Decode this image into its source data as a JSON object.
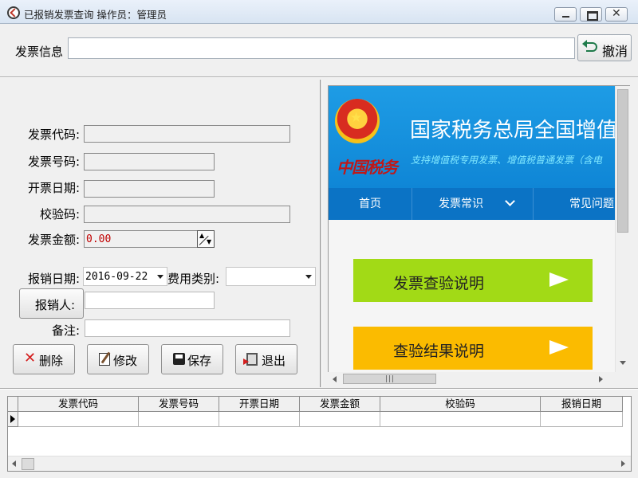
{
  "window": {
    "title": "已报销发票查询  操作员：管理员",
    "close_glyph": "✕"
  },
  "info": {
    "label": "发票信息",
    "value": "",
    "undo_label": "撤消"
  },
  "form": {
    "invoice_code_label": "发票代码:",
    "invoice_code": "",
    "invoice_number_label": "发票号码:",
    "invoice_number": "",
    "issue_date_label": "开票日期:",
    "issue_date": "",
    "check_code_label": "校验码:",
    "check_code": "",
    "amount_label": "发票金额:",
    "amount": "0.00",
    "reimburse_date_label": "报销日期:",
    "reimburse_date": "2016-09-22",
    "expense_type_label": "费用类别:",
    "expense_type": "",
    "reimburser_label": "报销人:",
    "reimburser": "",
    "note_label": "备注:",
    "note": ""
  },
  "actions": {
    "delete": "删除",
    "edit": "修改",
    "save": "保存",
    "exit": "退出"
  },
  "browser": {
    "emblem_text": "中国税务",
    "title": "国家税务总局全国增值",
    "subtitle": "支持增值税专用发票、增值税普通发票（含电",
    "nav": [
      "首页",
      "发票常识",
      "常见问题"
    ],
    "cards": [
      "发票查验说明",
      "查验结果说明"
    ],
    "hscroll_grip": "|||"
  },
  "grid": {
    "columns": [
      "发票代码",
      "发票号码",
      "开票日期",
      "发票金额",
      "校验码",
      "报销日期"
    ]
  },
  "colors": {
    "banner_blue": "#1e9ce5",
    "nav_blue": "#0b73c5",
    "card_green": "#a2da16",
    "card_yellow": "#fbbb00",
    "amount_red": "#c00000"
  }
}
